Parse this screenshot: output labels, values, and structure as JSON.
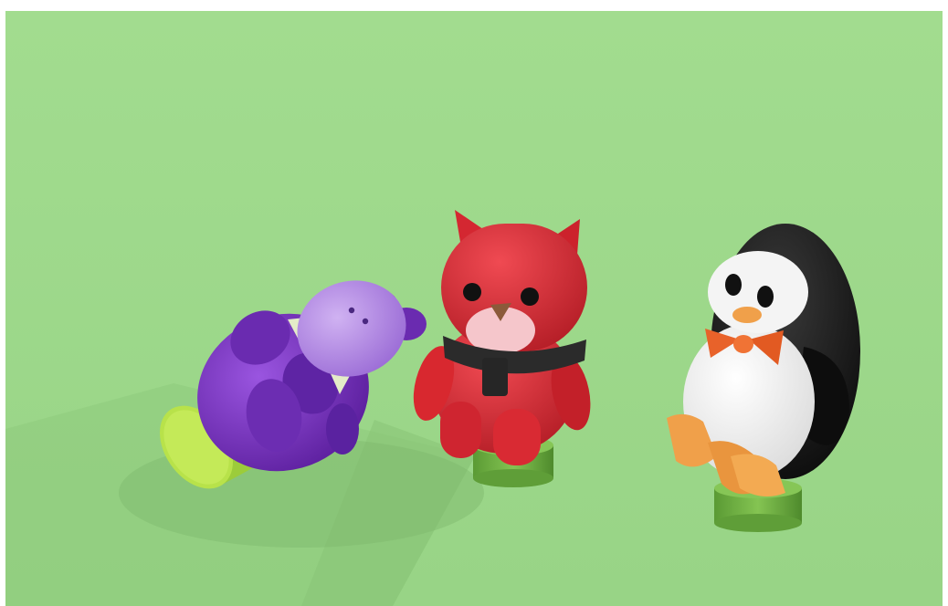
{
  "scene": {
    "subjects": [
      "hippo-toy",
      "cat-toy",
      "penguin-toy"
    ],
    "colors": {
      "frame": "#ffffff",
      "floor": "#9ed98c",
      "shadow": "#86c274",
      "hippo": "#7a34c4",
      "hippo_head": "#b78ee6",
      "hippo_base": "#b8e24a",
      "cat": "#e0303a",
      "cat_muzzle": "#f5c6cb",
      "scarf": "#2b2b2b",
      "penguin_black": "#161616",
      "penguin_white": "#f7f7f7",
      "bowtie": "#e8622a",
      "feet": "#f0a04a",
      "stand": "#74b844"
    }
  }
}
